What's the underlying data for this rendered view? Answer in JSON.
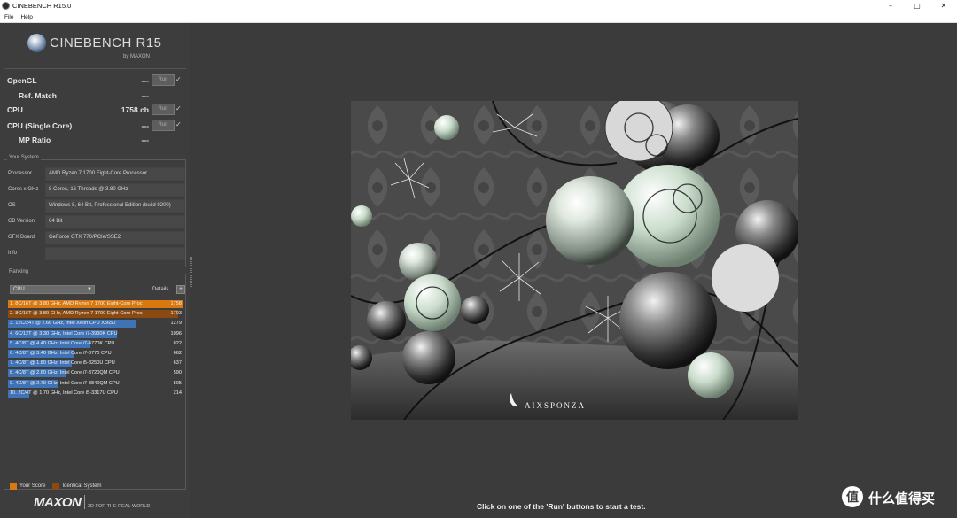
{
  "window": {
    "title": "CINEBENCH R15.0",
    "controls": [
      "–",
      "▢",
      "✕"
    ]
  },
  "menu": [
    "File",
    "Help"
  ],
  "logo": {
    "brand": "CINEBENCH R15",
    "sub": "by MAXON"
  },
  "benchmarks": [
    {
      "label": "OpenGL",
      "value": "---",
      "run": "Run",
      "check": "✓",
      "indent": false,
      "has_run": true
    },
    {
      "label": "Ref. Match",
      "value": "---",
      "indent": true,
      "has_run": false
    },
    {
      "label": "CPU",
      "value": "1758 cb",
      "run": "Run",
      "check": "✓",
      "indent": false,
      "has_run": true
    },
    {
      "label": "CPU (Single Core)",
      "value": "---",
      "run": "Run",
      "check": "✓",
      "indent": false,
      "has_run": true
    },
    {
      "label": "MP Ratio",
      "value": "---",
      "indent": true,
      "has_run": false
    }
  ],
  "your_system": {
    "title": "Your System",
    "rows": [
      {
        "key": "Processor",
        "value": "AMD Ryzen 7 1700 Eight-Core Processor"
      },
      {
        "key": "Cores x GHz",
        "value": "8 Cores, 16 Threads @ 3.80 GHz"
      },
      {
        "key": "OS",
        "value": "Windows 8, 64 Bit, Professional Edition (build 9200)"
      },
      {
        "key": "CB Version",
        "value": "64 Bit"
      },
      {
        "key": "GFX Board",
        "value": "GeForce GTX 770/PCIe/SSE2"
      },
      {
        "key": "Info",
        "value": ""
      }
    ]
  },
  "ranking": {
    "title": "Ranking",
    "select_value": "CPU",
    "details_label": "Details",
    "details_btn": "+",
    "rows": [
      {
        "text": "1. 8C/16T @ 3.80 GHz, AMD Ryzen 7 1700 Eight-Core Proc",
        "score": "1758",
        "score_value": 1758,
        "color": "#d9780f"
      },
      {
        "text": "2. 8C/16T @ 3.80 GHz, AMD Ryzen 7 1700 Eight-Core Proc",
        "score": "1703",
        "score_value": 1703,
        "color": "#8a4a12"
      },
      {
        "text": "3. 12C/24T @ 2.66 GHz, Intel Xeon CPU X5650",
        "score": "1279",
        "score_value": 1279,
        "color": "#3f73b6"
      },
      {
        "text": "4. 6C/12T @ 3.30 GHz,  Intel Core i7-3930K CPU",
        "score": "1096",
        "score_value": 1096,
        "color": "#3f73b6"
      },
      {
        "text": "5. 4C/8T @ 4.40 GHz, Intel Core i7-4770K CPU",
        "score": "822",
        "score_value": 822,
        "color": "#3f73b6"
      },
      {
        "text": "6. 4C/8T @ 3.40 GHz,  Intel Core i7-3770 CPU",
        "score": "662",
        "score_value": 662,
        "color": "#3f73b6"
      },
      {
        "text": "7. 4C/8T @ 1.80 GHz, Intel Core i5-8250U CPU",
        "score": "637",
        "score_value": 637,
        "color": "#3f73b6"
      },
      {
        "text": "8. 4C/8T @ 2.60 GHz, Intel Core i7-3720QM CPU",
        "score": "590",
        "score_value": 590,
        "color": "#3f73b6"
      },
      {
        "text": "9. 4C/8T @ 2.79 GHz,  Intel Core i7-3840QM CPU",
        "score": "505",
        "score_value": 505,
        "color": "#3f73b6"
      },
      {
        "text": "10. 2C/4T @ 1.70 GHz,  Intel Core i5-3317U CPU",
        "score": "214",
        "score_value": 214,
        "color": "#3f73b6"
      }
    ],
    "legend": [
      {
        "label": "Your Score",
        "color": "#d9780f"
      },
      {
        "label": "Identical System",
        "color": "#8a4a12"
      }
    ]
  },
  "footer": {
    "brand": "MAXON",
    "tagline": "3D FOR THE REAL WORLD"
  },
  "render": {
    "signature": "AIXSPONZA"
  },
  "status": "Click on one of the 'Run' buttons to start a test.",
  "watermark": {
    "icon": "值",
    "text": "什么值得买"
  }
}
